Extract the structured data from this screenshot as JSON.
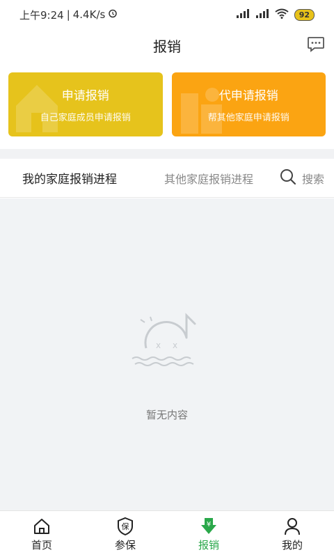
{
  "status_bar": {
    "time": "上午9:24",
    "network_speed": "4.4K/s",
    "battery": "92"
  },
  "header": {
    "title": "报销"
  },
  "cards": {
    "apply": {
      "title": "申请报销",
      "subtitle": "自己家庭成员申请报销",
      "color": "#e6c31c"
    },
    "proxy": {
      "title": "代申请报销",
      "subtitle": "帮其他家庭申请报销",
      "color": "#fba412"
    }
  },
  "tabs": {
    "mine": "我的家庭报销进程",
    "other": "其他家庭报销进程",
    "search": "搜索"
  },
  "empty": {
    "text": "暂无内容"
  },
  "bottom_nav": {
    "items": [
      {
        "label": "首页",
        "icon": "home-icon"
      },
      {
        "label": "参保",
        "icon": "insurance-icon"
      },
      {
        "label": "报销",
        "icon": "reimburse-icon",
        "active": true
      },
      {
        "label": "我的",
        "icon": "user-icon"
      }
    ],
    "active_color": "#2aa84a"
  }
}
